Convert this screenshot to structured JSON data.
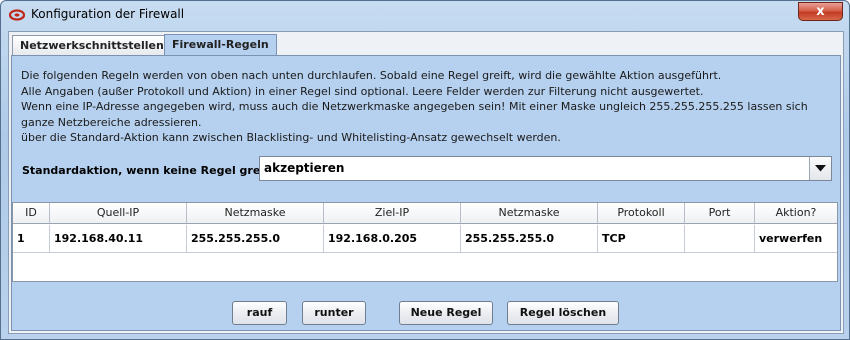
{
  "window": {
    "title": "Konfiguration der Firewall",
    "close_symbol": "x",
    "app_icon": "firewall-app-icon"
  },
  "tabs": [
    {
      "label": "Netzwerkschnittstellen",
      "active": false
    },
    {
      "label": "Firewall-Regeln",
      "active": true
    }
  ],
  "description": [
    "Die folgenden Regeln werden von oben nach unten durchlaufen. Sobald eine Regel greift, wird die gewählte Aktion ausgeführt.",
    "Alle Angaben (außer Protokoll und Aktion) in einer Regel sind optional. Leere Felder werden zur Filterung nicht ausgewertet.",
    "Wenn eine IP-Adresse angegeben wird, muss auch die Netzwerkmaske angegeben sein! Mit einer Maske ungleich 255.255.255.255 lassen sich",
    "ganze Netzbereiche adressieren.",
    "über die Standard-Aktion kann zwischen Blacklisting- und Whitelisting-Ansatz gewechselt werden."
  ],
  "default_action": {
    "label": "Standardaktion, wenn keine Regel greift:",
    "value": "akzeptieren"
  },
  "table": {
    "headers": [
      "ID",
      "Quell-IP",
      "Netzmaske",
      "Ziel-IP",
      "Netzmaske",
      "Protokoll",
      "Port",
      "Aktion?"
    ],
    "rows": [
      [
        "1",
        "192.168.40.11",
        "255.255.255.0",
        "192.168.0.205",
        "255.255.255.0",
        "TCP",
        "",
        "verwerfen"
      ]
    ]
  },
  "buttons": {
    "up": "rauf",
    "down": "runter",
    "new_rule": "Neue Regel",
    "delete_rule": "Regel löschen"
  },
  "colors": {
    "panel_bg": "#b6d1ef",
    "close_red": "#c23a22"
  }
}
